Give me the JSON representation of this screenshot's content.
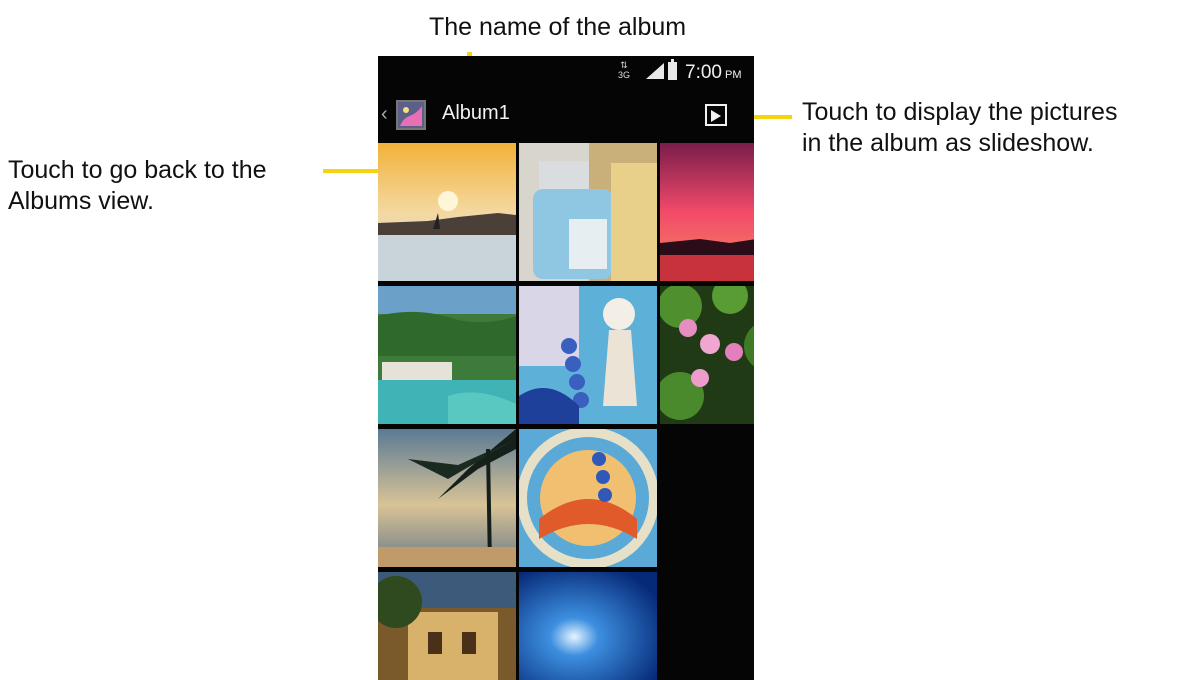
{
  "annotations": {
    "album_name": "The name of the album",
    "back_line1": "Touch to go back to the",
    "back_line2": "Albums view.",
    "slideshow_line1": "Touch to display the pictures",
    "slideshow_line2": "in the album as slideshow."
  },
  "status_bar": {
    "network": "3G",
    "time": "7:00",
    "ampm": "PM"
  },
  "action_bar": {
    "title": "Album1",
    "back_icon": "chevron-left-icon",
    "slideshow_icon": "play-icon"
  },
  "photos": [
    {
      "subject": "sunset-bay"
    },
    {
      "subject": "sanitizer-bottle"
    },
    {
      "subject": "red-sunset"
    },
    {
      "subject": "coastal-village"
    },
    {
      "subject": "surf-art"
    },
    {
      "subject": "water-lilies"
    },
    {
      "subject": "palm-beach"
    },
    {
      "subject": "surfboard-art"
    },
    {
      "subject": "stone-villa"
    },
    {
      "subject": "underwater-sun"
    }
  ],
  "colors": {
    "leader": "#f5d40f",
    "screen_background": "#050505"
  }
}
